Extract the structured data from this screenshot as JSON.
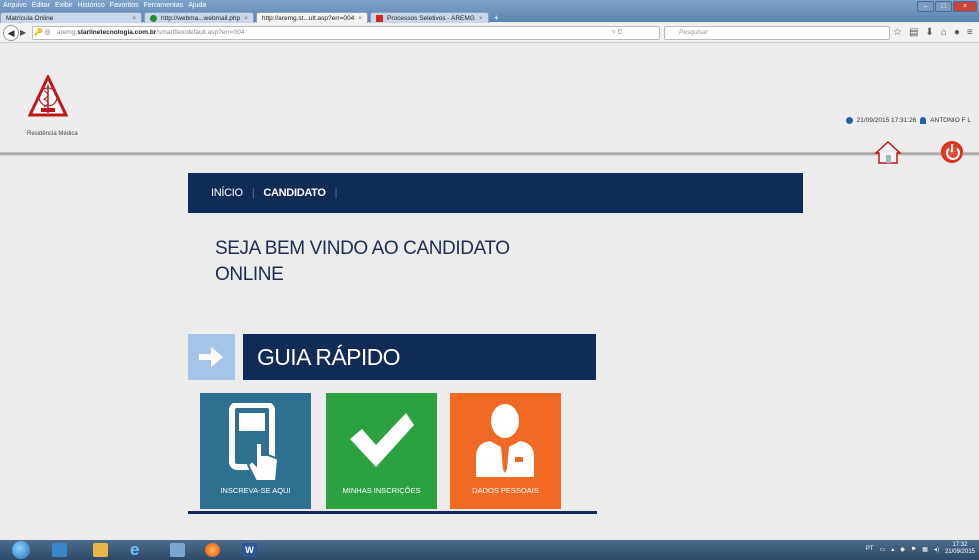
{
  "menu": [
    "Arquivo",
    "Editar",
    "Exibir",
    "Histórico",
    "Favoritos",
    "Ferramentas",
    "Ajuda"
  ],
  "tabs": [
    {
      "label": "Matrícula Online",
      "icon_color": "#3aa0d8"
    },
    {
      "label": "http://webma...webmail.php",
      "icon_color": "#2b8a2b"
    },
    {
      "label": "http://aremg.st...ult.asp?err=004",
      "icon_color": "#1f5fbf"
    },
    {
      "label": "Processos Seletivos - AREMG",
      "icon_color": "#d8281e"
    }
  ],
  "url": {
    "domain_prefix": "aremg.",
    "domain_bold": "starlinetecnologia.com.br",
    "path": "/smartflex/default.asp?err=004"
  },
  "search": {
    "placeholder": "Pesquisar"
  },
  "logo": {
    "caption": "Residência Médica",
    "ring_text": "Associação de Apoio"
  },
  "header": {
    "datetime": "21/09/2015 17:31:26",
    "user": "ANTONIO F L"
  },
  "nav": {
    "home": "INÍCIO",
    "candidate": "CANDIDATO"
  },
  "welcome": {
    "line1": "SEJA BEM VINDO AO CANDIDATO",
    "line2": "ONLINE"
  },
  "guide": {
    "title": "GUIA RÁPIDO"
  },
  "tiles": [
    {
      "label": "INSCREVA-SE AQUI",
      "color": "#2e7090"
    },
    {
      "label": "MINHAS INSCRIÇÕES",
      "color": "#2ba140"
    },
    {
      "label": "DADOS PESSOAIS",
      "color": "#f16a23"
    }
  ],
  "taskbar": {
    "lang": "PT",
    "time": "17:32",
    "date": "21/09/2015"
  }
}
